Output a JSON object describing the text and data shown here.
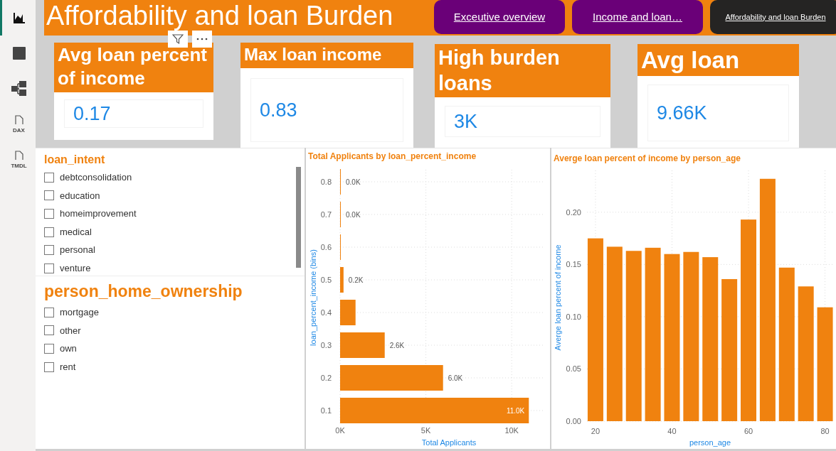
{
  "sidebar": {
    "items": [
      {
        "kind": "report",
        "selected": true
      },
      {
        "kind": "table",
        "selected": false
      },
      {
        "kind": "model",
        "selected": false
      },
      {
        "kind": "file",
        "label": "DAX",
        "selected": false
      },
      {
        "kind": "file",
        "label": "TMDL",
        "selected": false
      }
    ]
  },
  "header": {
    "title": "Affordability and loan Burden"
  },
  "nav_buttons": [
    {
      "label": "Exceutive overview",
      "selected": false
    },
    {
      "label": "Income and loan…",
      "selected": false
    },
    {
      "label": "Affordability and loan Burden",
      "selected": true
    }
  ],
  "kpi_cards": [
    {
      "title": "Avg loan percent of income",
      "value": "0.17"
    },
    {
      "title": "Max loan income",
      "value": "0.83"
    },
    {
      "title": "High burden loans",
      "value": "3K"
    },
    {
      "title": "Avg loan",
      "value": "9.66K"
    }
  ],
  "slicers": [
    {
      "title": "loan_intent",
      "items": [
        {
          "label": "debtconsolidation",
          "checked": false
        },
        {
          "label": "education",
          "checked": false
        },
        {
          "label": "homeimprovement",
          "checked": false
        },
        {
          "label": "medical",
          "checked": false
        },
        {
          "label": "personal",
          "checked": false
        },
        {
          "label": "venture",
          "checked": false
        }
      ]
    },
    {
      "title": "person_home_ownership",
      "items": [
        {
          "label": "mortgage",
          "checked": false
        },
        {
          "label": "other",
          "checked": false
        },
        {
          "label": "own",
          "checked": false
        },
        {
          "label": "rent",
          "checked": false
        }
      ]
    }
  ],
  "charts": [
    {
      "chart_data": {
        "type": "bar",
        "orientation": "horizontal",
        "title": "Total Applicants by loan_percent_income",
        "xlabel": "Total Applicants",
        "ylabel": "loan_percent_income (bins)",
        "categories": [
          "0.8",
          "0.7",
          "0.6",
          "0.5",
          "0.4",
          "0.3",
          "0.2",
          "0.1"
        ],
        "series": [
          {
            "color": "#f0820f",
            "values": [
              30,
              20,
              10,
              200,
              900,
              2600,
              6000,
              11000
            ]
          }
        ],
        "grid": true,
        "value_labels": [
          "0.0K",
          "0.0K",
          null,
          "0.2K",
          null,
          "2.6K",
          "6.0K",
          "11.0K"
        ],
        "xlim": [
          0,
          11900
        ],
        "xticks": [
          {
            "value": 0,
            "label": "0K"
          },
          {
            "value": 5000,
            "label": "5K"
          },
          {
            "value": 10000,
            "label": "10K"
          }
        ]
      }
    },
    {
      "chart_data": {
        "type": "bar",
        "orientation": "vertical",
        "title": "Averge loan percent of income by person_age",
        "xlabel": "person_age",
        "ylabel": "Averge loan percent of income",
        "x": [
          20,
          25,
          30,
          35,
          40,
          45,
          50,
          55,
          60,
          65,
          70,
          75,
          80
        ],
        "series": [
          {
            "color": "#f0820f",
            "values": [
              0.175,
              0.167,
              0.163,
              0.166,
              0.16,
              0.162,
              0.157,
              0.136,
              0.193,
              0.232,
              0.147,
              0.129,
              0.109
            ]
          }
        ],
        "grid": true,
        "xlim": [
          17.5,
          82.5
        ],
        "ylim": [
          0,
          0.24
        ],
        "xticks": [
          20,
          40,
          60,
          80
        ],
        "yticks": [
          {
            "value": 0,
            "label": "0.00"
          },
          {
            "value": 0.05,
            "label": "0.05"
          },
          {
            "value": 0.1,
            "label": "0.10"
          },
          {
            "value": 0.15,
            "label": "0.15"
          },
          {
            "value": 0.2,
            "label": "0.20"
          }
        ]
      }
    }
  ]
}
